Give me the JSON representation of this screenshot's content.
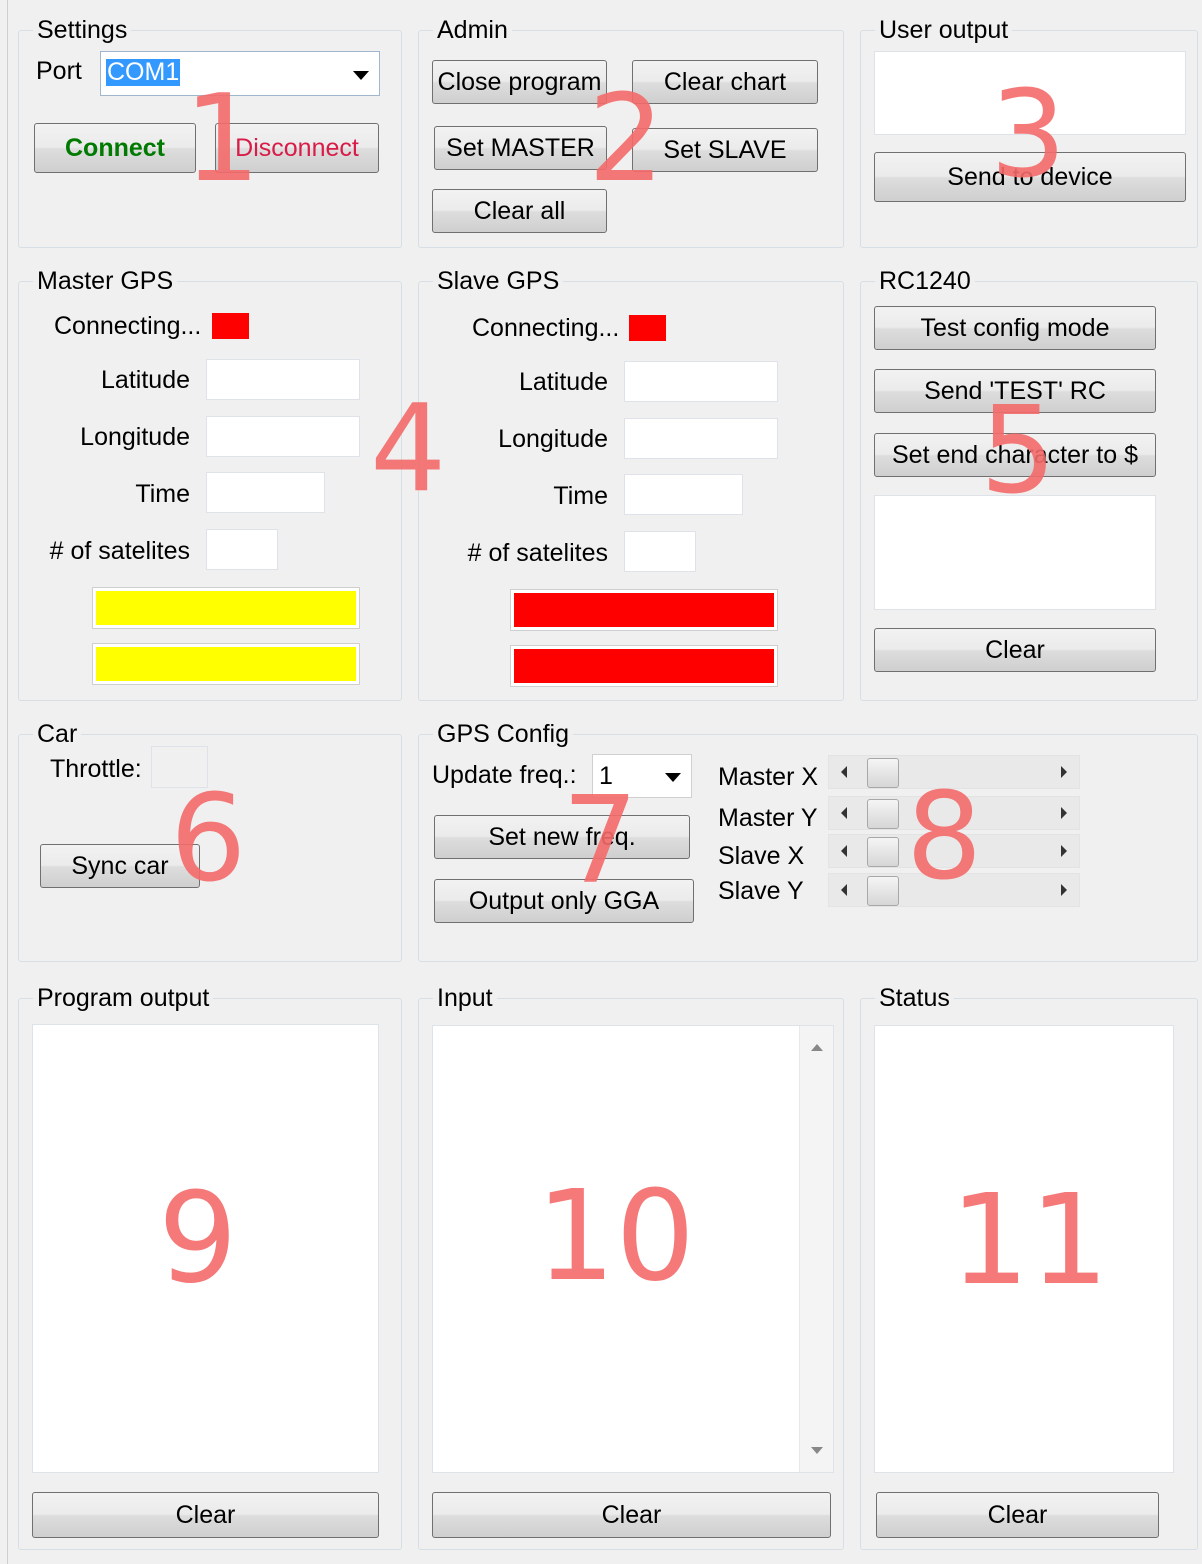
{
  "settings": {
    "title": "Settings",
    "port_label": "Port",
    "port_value": "COM1",
    "connect": "Connect",
    "disconnect": "Disconnect",
    "connect_color": "#007a00",
    "disconnect_color": "#d81b47"
  },
  "admin": {
    "title": "Admin",
    "close_program": "Close program",
    "clear_chart": "Clear chart",
    "set_master": "Set MASTER",
    "set_slave": "Set SLAVE",
    "clear_all": "Clear all"
  },
  "user_output": {
    "title": "User output",
    "send": "Send to device"
  },
  "master_gps": {
    "title": "Master GPS",
    "status": "Connecting...",
    "status_color": "#ff0000",
    "latitude": "Latitude",
    "longitude": "Longitude",
    "time": "Time",
    "satellites": "# of satelites",
    "bar_color": "#ffff00"
  },
  "slave_gps": {
    "title": "Slave GPS",
    "status": "Connecting...",
    "status_color": "#ff0000",
    "latitude": "Latitude",
    "longitude": "Longitude",
    "time": "Time",
    "satellites": "# of satelites",
    "bar_color": "#ff0000"
  },
  "rc1240": {
    "title": "RC1240",
    "test_config": "Test config mode",
    "send_test": "Send 'TEST' RC",
    "set_end_char": "Set end character to $",
    "clear": "Clear"
  },
  "car": {
    "title": "Car",
    "throttle": "Throttle:",
    "sync": "Sync car"
  },
  "gps_config": {
    "title": "GPS Config",
    "update_freq": "Update freq.:",
    "freq_value": "1",
    "set_new_freq": "Set new freq.",
    "output_gga": "Output only GGA",
    "master_x": "Master X",
    "master_y": "Master Y",
    "slave_x": "Slave X",
    "slave_y": "Slave Y"
  },
  "program_output": {
    "title": "Program output",
    "clear": "Clear"
  },
  "input": {
    "title": "Input",
    "clear": "Clear"
  },
  "status": {
    "title": "Status",
    "clear": "Clear"
  },
  "annotations": [
    "1",
    "2",
    "3",
    "4",
    "5",
    "6",
    "7",
    "8",
    "9",
    "10",
    "11"
  ]
}
